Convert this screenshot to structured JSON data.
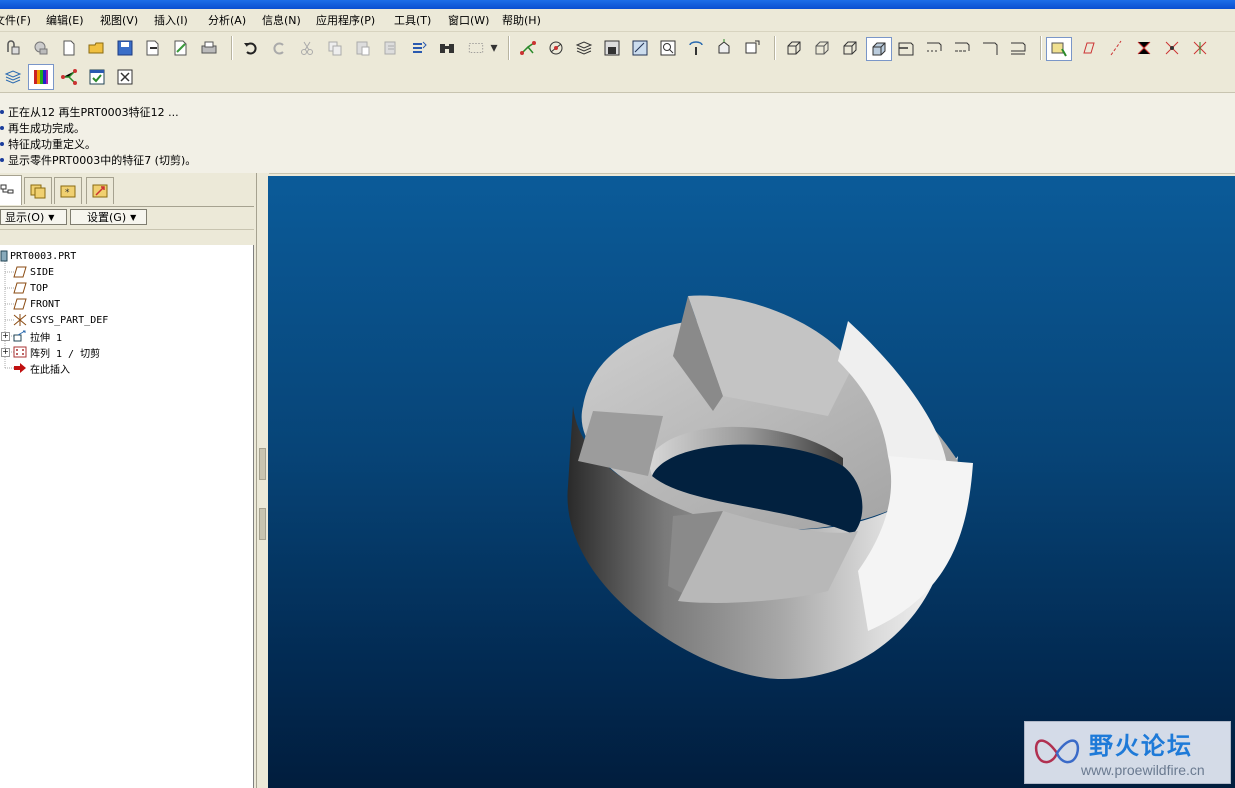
{
  "menubar": {
    "items": [
      "文件(F)",
      "编辑(E)",
      "视图(V)",
      "插入(I)",
      "分析(A)",
      "信息(N)",
      "应用程序(P)",
      "工具(T)",
      "窗口(W)",
      "帮助(H)"
    ]
  },
  "messages": [
    "正在从12 再生PRT0003特征12 ...",
    "再生成功完成。",
    "特征成功重定义。",
    "显示零件PRT0003中的特征7 (切剪)。"
  ],
  "navigator": {
    "tabs": [
      "model-tree-tab",
      "folder-browser-tab",
      "favorites-tab",
      "connections-tab"
    ],
    "show_button": "显示(O)",
    "settings_button": "设置(G)"
  },
  "tree": {
    "root": "PRT0003.PRT",
    "items": [
      {
        "label": "SIDE",
        "icon": "datum-plane-icon"
      },
      {
        "label": "TOP",
        "icon": "datum-plane-icon"
      },
      {
        "label": "FRONT",
        "icon": "datum-plane-icon"
      },
      {
        "label": "CSYS_PART_DEF",
        "icon": "coordinate-system-icon"
      },
      {
        "label": "拉伸 1",
        "icon": "extrude-icon",
        "expandable": true
      },
      {
        "label": "阵列 1 / 切剪",
        "icon": "pattern-icon",
        "expandable": true
      },
      {
        "label": "在此插入",
        "icon": "insert-here-arrow-icon"
      }
    ]
  },
  "watermark": {
    "title": "野火论坛",
    "url": "www.proewildfire.cn"
  },
  "colors": {
    "graphics_top": "#0b5b99",
    "graphics_bottom": "#011d3d",
    "title_bar": "#0a4fd0"
  }
}
